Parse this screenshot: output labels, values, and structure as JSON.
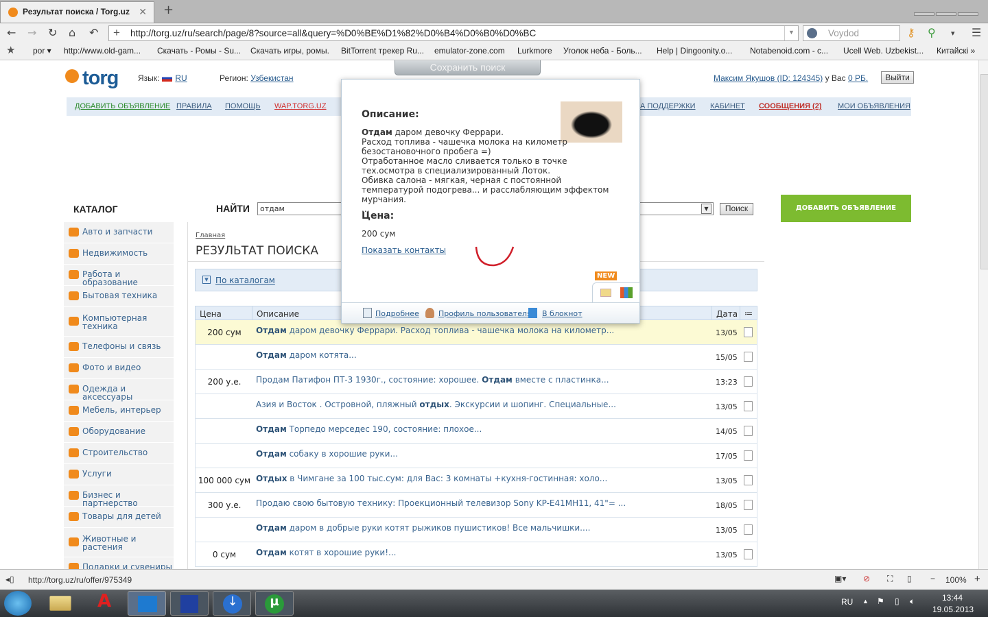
{
  "browser": {
    "tab_title": "Результат поиска / Torg.uz",
    "url": "http://torg.uz/ru/search/page/8?source=all&query=%D0%BE%D1%82%D0%B4%D0%B0%D0%BC",
    "search_placeholder": "Voydod",
    "bookmarks": [
      "por ▾",
      "http://www.old-gam...",
      "Скачать - Ромы - Su...",
      "Скачать игры, ромы.",
      "BitTorrent трекер Ru...",
      "emulator-zone.com",
      "Lurkmore",
      "Уголок неба - Боль...",
      "Help | Dingoonity.o...",
      "Notabenoid.com - c...",
      "Ucell Web. Uzbekist...",
      "Китайскі »"
    ],
    "status_url": "http://torg.uz/ru/offer/975349",
    "zoom": "100%"
  },
  "header": {
    "logo": "torg",
    "lang_label": "Язык:",
    "lang": "RU",
    "region_label": "Регион:",
    "region": "Узбекистан",
    "user": "Максим Якушов (ID: 124345)",
    "balance_label": "у Вас",
    "balance": "0 РБ.",
    "logout": "Выйти",
    "save_search": "Сохранить поиск"
  },
  "nav": [
    {
      "label": "ДОБАВИТЬ ОБЪЯВЛЕНИЕ",
      "color": "#2a8a2a"
    },
    {
      "label": "ПРАВИЛА"
    },
    {
      "label": "ПОМОЩЬ"
    },
    {
      "label": "WAP.TORG.UZ",
      "color": "#d03030"
    },
    {
      "label": "А ПОДДЕРЖКИ"
    },
    {
      "label": "КАБИНЕТ"
    },
    {
      "label": "СООБЩЕНИЯ (2)",
      "color": "#c0302a"
    },
    {
      "label": "МОИ ОБЪЯВЛЕНИЯ"
    }
  ],
  "search": {
    "catalog_label": "КАТАЛОГ",
    "find_label": "НАЙТИ",
    "query": "отдам",
    "button": "Поиск",
    "add_button": "ДОБАВИТЬ ОБЪЯВЛЕНИЕ"
  },
  "categories": [
    "Авто и запчасти",
    "Недвижимость",
    "Работа и образование",
    "Бытовая техника",
    "Компьютерная техника",
    "Телефоны и связь",
    "Фото и видео",
    "Одежда и аксессуары",
    "Мебель, интерьер",
    "Оборудование",
    "Строительство",
    "Услуги",
    "Бизнес и партнерство",
    "Товары для детей",
    "Животные и растения",
    "Подарки и сувениры"
  ],
  "main": {
    "breadcrumb": "Главная",
    "title": "РЕЗУЛЬТАТ ПОИСКА",
    "by_catalog": "По каталогам",
    "columns": [
      "Цена",
      "Описание",
      "Дата"
    ],
    "rows": [
      {
        "price": "200 сум",
        "pre": "",
        "bold": "Отдам",
        "post": " даром девочку Феррари. Расход топлива - чашечка молока на километр...",
        "date": "13/05"
      },
      {
        "price": "",
        "pre": "",
        "bold": "Отдам",
        "post": " даром котята...",
        "date": "15/05"
      },
      {
        "price": "200 у.е.",
        "pre": "Продам Патифон ПТ-3 1930г., состояние: хорошее. ",
        "bold": "Отдам",
        "post": " вместе с пластинка...",
        "date": "13:23"
      },
      {
        "price": "",
        "pre": "Азия и Восток . Островной, пляжный ",
        "bold": "отдых",
        "post": ". Экскурсии и шопинг. Специальные...",
        "date": "13/05"
      },
      {
        "price": "",
        "pre": "",
        "bold": "Отдам",
        "post": " Торпедо мерседес 190, состояние: плохое...",
        "date": "14/05"
      },
      {
        "price": "",
        "pre": "",
        "bold": "Отдам",
        "post": " собаку в хорошие руки...",
        "date": "17/05"
      },
      {
        "price": "100 000 сум",
        "pre": "",
        "bold": "Отдых",
        "post": " в Чимгане за 100 тыс.сум: для Вас: 3 комнаты +кухня-гостинная: холо...",
        "date": "13/05"
      },
      {
        "price": "300 у.е.",
        "pre": "Продаю свою бытовую технику: Проекционный телевизор Sony KP-E41MH11, 41\"= ...",
        "bold": "",
        "post": "",
        "date": "18/05"
      },
      {
        "price": "",
        "pre": "",
        "bold": "Отдам",
        "post": " даром в добрые руки котят рыжиков пушистиков! Все мальчишки....",
        "date": "13/05"
      },
      {
        "price": "0 сум",
        "pre": "",
        "bold": "Отдам",
        "post": " котят в хорошие руки!...",
        "date": "13/05"
      }
    ]
  },
  "popup": {
    "desc_label": "Описание:",
    "desc_bold": "Отдам",
    "desc": " даром девочку Феррари.\nРасход топлива - чашечка молока на километр\nбезостановочного пробега =)\nОтработанное масло сливается только в точке тех.осмотра в специализированный Лоток.\nОбивка салона - мягкая, черная с постоянной температурой подогрева... и расслабляющим эффектом мурчания.\n...",
    "price_label": "Цена:",
    "price": "200 сум",
    "contacts": "Показать контакты",
    "new_badge": "NEW",
    "more": "Подробнее",
    "profile": "Профиль пользователя",
    "notepad": "В блокнот"
  },
  "taskbar": {
    "lang": "RU",
    "time": "13:44",
    "date": "19.05.2013"
  }
}
